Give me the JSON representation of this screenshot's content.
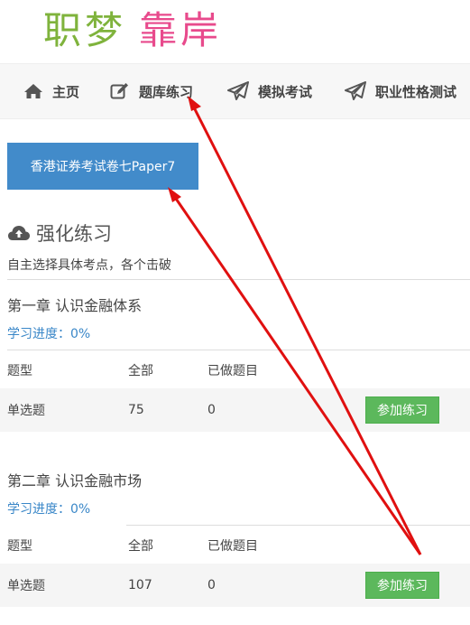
{
  "logo": {
    "part1": "职梦",
    "part2": "靠岸"
  },
  "nav": {
    "home": "主页",
    "question_bank": "题库练习",
    "mock_exam": "模拟考试",
    "personality_test": "职业性格测试"
  },
  "paper_button": "香港证券考试卷七Paper7",
  "section": {
    "title": "强化练习",
    "subtitle": "自主选择具体考点，各个击破"
  },
  "table_headers": {
    "type": "题型",
    "total": "全部",
    "done": "已做题目"
  },
  "chapters": [
    {
      "title": "第一章 认识金融体系",
      "progress": "学习进度：0%",
      "row": {
        "type": "单选题",
        "total": "75",
        "done": "0",
        "action": "参加练习"
      }
    },
    {
      "title": "第二章 认识金融市场",
      "progress": "学习进度：0%",
      "row": {
        "type": "单选题",
        "total": "107",
        "done": "0",
        "action": "参加练习"
      }
    }
  ],
  "colors": {
    "primary": "#428bca",
    "success": "#5cb85c",
    "link": "#3a87c8",
    "annotation": "#e01010"
  }
}
